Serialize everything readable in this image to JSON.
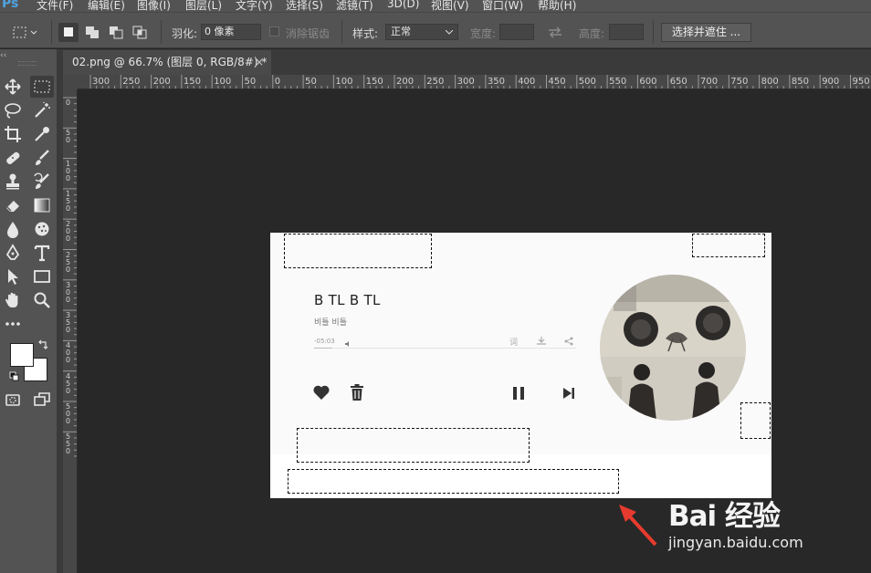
{
  "app": {
    "logo": "Ps"
  },
  "menu": [
    "文件(F)",
    "编辑(E)",
    "图像(I)",
    "图层(L)",
    "文字(Y)",
    "选择(S)",
    "滤镜(T)",
    "3D(D)",
    "视图(V)",
    "窗口(W)",
    "帮助(H)"
  ],
  "options": {
    "feather_label": "羽化:",
    "feather_value": "0 像素",
    "antialias_label": "消除锯齿",
    "style_label": "样式:",
    "style_value": "正常",
    "width_label": "宽度:",
    "height_label": "高度:",
    "select_mask_button": "选择并遮住 ..."
  },
  "document": {
    "tab_title": "02.png @ 66.7% (图层 0, RGB/8#) *",
    "close_glyph": "×"
  },
  "rulers": {
    "horizontal": [
      "300",
      "250",
      "200",
      "150",
      "100",
      "50",
      "0",
      "50",
      "100",
      "150",
      "200",
      "250",
      "300",
      "350",
      "400",
      "450",
      "500",
      "550",
      "600",
      "650",
      "700",
      "750",
      "800",
      "850",
      "900",
      "950"
    ],
    "vertical": [
      "0",
      "50",
      "100",
      "150",
      "200",
      "250",
      "300",
      "350",
      "400",
      "450",
      "500",
      "550"
    ]
  },
  "player": {
    "title": "B TL B TL",
    "artist": "비틀 비틀",
    "time": "-05:03",
    "progress": 0.07,
    "icons": [
      "volume-icon",
      "lyrics-icon",
      "download-icon",
      "share-icon",
      "heart-icon",
      "trash-icon",
      "pause-icon",
      "next-icon"
    ],
    "lyrics_glyph": "词"
  },
  "watermark": {
    "brand": "Bai 经验",
    "url": "jingyan.baidu.com"
  },
  "colors": {
    "accent": "#4fa3e0",
    "annotation_arrow": "#e63b2e"
  }
}
